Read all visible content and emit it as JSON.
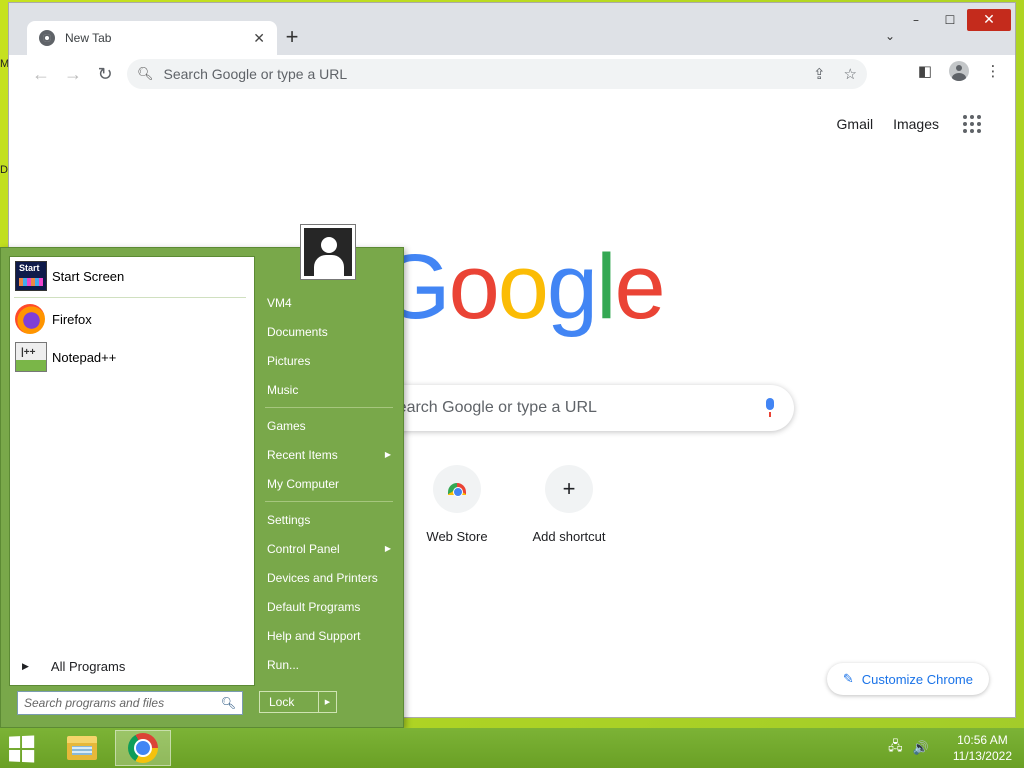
{
  "desktop": {
    "edge_labels": [
      "M",
      "D"
    ]
  },
  "browser": {
    "window_controls": {
      "minimize": "–",
      "maximize": "☐",
      "close": "✕"
    },
    "tab": {
      "title": "New Tab",
      "close": "✕"
    },
    "new_tab": "+",
    "tab_search": "⌄",
    "omnibox": {
      "placeholder": "Search Google or type a URL"
    },
    "top_links": {
      "gmail": "Gmail",
      "images": "Images"
    },
    "logo_letters": [
      {
        "ch": "G",
        "color": "#4285f4"
      },
      {
        "ch": "o",
        "color": "#ea4335"
      },
      {
        "ch": "o",
        "color": "#fbbc05"
      },
      {
        "ch": "g",
        "color": "#4285f4"
      },
      {
        "ch": "l",
        "color": "#34a853"
      },
      {
        "ch": "e",
        "color": "#ea4335"
      }
    ],
    "search_box": {
      "placeholder": "Search Google or type a URL"
    },
    "shortcuts": [
      {
        "label": "Web Store"
      },
      {
        "label": "Add shortcut",
        "icon": "+"
      }
    ],
    "customize": {
      "label": "Customize Chrome",
      "icon": "✎"
    }
  },
  "start_menu": {
    "pinned": [
      {
        "label": "Start Screen",
        "icon_text": "Start"
      },
      {
        "label": "Firefox"
      },
      {
        "label": "Notepad++",
        "icon_text": "|++"
      }
    ],
    "all_programs": "All Programs",
    "search": {
      "placeholder": "Search programs and files"
    },
    "right_items": [
      {
        "label": "VM4"
      },
      {
        "label": "Documents"
      },
      {
        "label": "Pictures"
      },
      {
        "label": "Music"
      },
      {
        "label": "Games"
      },
      {
        "label": "Recent Items",
        "submenu": true
      },
      {
        "label": "My Computer"
      },
      {
        "label": "Settings"
      },
      {
        "label": "Control Panel",
        "submenu": true
      },
      {
        "label": "Devices and Printers"
      },
      {
        "label": "Default Programs"
      },
      {
        "label": "Help and Support"
      },
      {
        "label": "Run..."
      }
    ],
    "lock": {
      "label": "Lock",
      "arrow": "▶"
    }
  },
  "taskbar": {
    "clock": {
      "time": "10:56 AM",
      "date": "11/13/2022"
    },
    "tray": {
      "network": "🖧",
      "volume": "🔊"
    }
  },
  "colors": {
    "start_menu_bg": "#79a84a",
    "taskbar_bg": "#6aa025",
    "desktop_bg": "#b5d820",
    "accent_blue": "#1a73e8"
  }
}
